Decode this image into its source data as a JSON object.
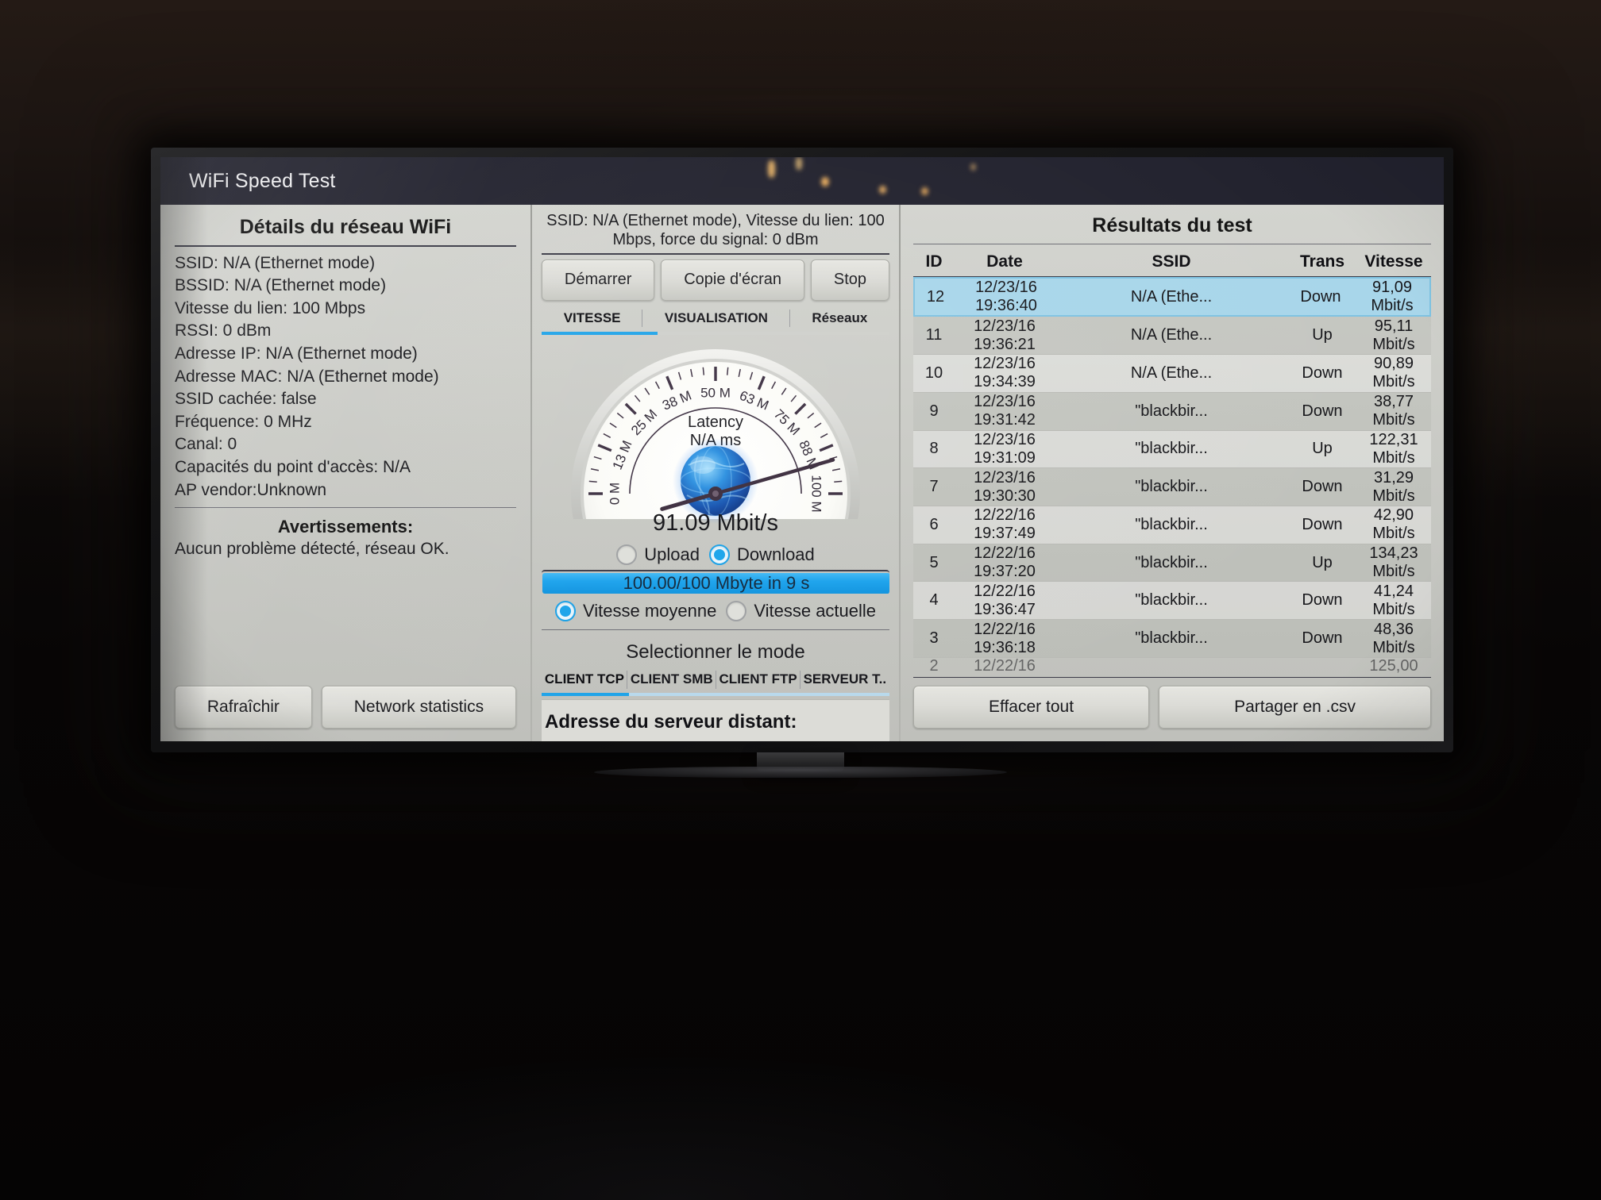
{
  "app": {
    "title": "WiFi Speed Test"
  },
  "left_panel": {
    "title": "Détails du réseau WiFi",
    "details": [
      "SSID: N/A (Ethernet mode)",
      "BSSID: N/A (Ethernet mode)",
      "Vitesse du lien: 100 Mbps",
      "RSSI: 0 dBm",
      "Adresse IP: N/A (Ethernet mode)",
      "Adresse MAC: N/A (Ethernet mode)",
      "SSID cachée: false",
      "Fréquence: 0 MHz",
      "Canal: 0",
      "Capacités du point d'accès: N/A",
      "AP vendor:Unknown"
    ],
    "warnings_title": "Avertissements:",
    "warnings_text": "Aucun problème détecté, réseau OK.",
    "buttons": {
      "refresh": "Rafraîchir",
      "network_statistics": "Network statistics"
    }
  },
  "center_panel": {
    "status_line": "SSID: N/A (Ethernet mode), Vitesse du lien: 100 Mbps, force du signal: 0 dBm",
    "buttons": {
      "start": "Démarrer",
      "screenshot": "Copie d'écran",
      "stop": "Stop"
    },
    "tabs": [
      {
        "label": "VITESSE",
        "active": true
      },
      {
        "label": "VISUALISATION",
        "active": false
      },
      {
        "label": "Réseaux",
        "active": false
      }
    ],
    "gauge": {
      "latency_label": "Latency",
      "latency_value": "N/A ms",
      "reading": "91.09 Mbit/s",
      "value": 91.09,
      "min": 0,
      "max": 100,
      "unit": "M",
      "tick_labels": [
        "0 M",
        "13 M",
        "25 M",
        "38 M",
        "50 M",
        "63 M",
        "75 M",
        "88 M",
        "100 M"
      ],
      "globe_icon": "globe-icon"
    },
    "direction": {
      "upload_label": "Upload",
      "download_label": "Download",
      "selected": "Download"
    },
    "progress": {
      "label": "100.00/100 Mbyte in 9 s",
      "percent": 100
    },
    "speed_mode": {
      "average_label": "Vitesse moyenne",
      "current_label": "Vitesse actuelle",
      "selected": "Vitesse moyenne"
    },
    "mode_title": "Selectionner le mode",
    "mode_tabs": [
      {
        "label": "CLIENT TCP",
        "active": true
      },
      {
        "label": "CLIENT SMB",
        "active": false
      },
      {
        "label": "CLIENT FTP",
        "active": false
      },
      {
        "label": "SERVEUR T..",
        "active": false
      }
    ],
    "server_label": "Adresse du serveur distant:"
  },
  "right_panel": {
    "title": "Résultats du test",
    "columns": [
      "ID",
      "Date",
      "SSID",
      "Trans",
      "Vitesse"
    ],
    "rows": [
      {
        "id": "12",
        "date": "12/23/16",
        "time": "19:36:40",
        "ssid": "N/A (Ethe...",
        "trans": "Down",
        "speed": "91,09",
        "unit": "Mbit/s",
        "selected": true
      },
      {
        "id": "11",
        "date": "12/23/16",
        "time": "19:36:21",
        "ssid": "N/A (Ethe...",
        "trans": "Up",
        "speed": "95,11",
        "unit": "Mbit/s",
        "selected": false
      },
      {
        "id": "10",
        "date": "12/23/16",
        "time": "19:34:39",
        "ssid": "N/A (Ethe...",
        "trans": "Down",
        "speed": "90,89",
        "unit": "Mbit/s",
        "selected": false
      },
      {
        "id": "9",
        "date": "12/23/16",
        "time": "19:31:42",
        "ssid": "\"blackbir...",
        "trans": "Down",
        "speed": "38,77",
        "unit": "Mbit/s",
        "selected": false
      },
      {
        "id": "8",
        "date": "12/23/16",
        "time": "19:31:09",
        "ssid": "\"blackbir...",
        "trans": "Up",
        "speed": "122,31",
        "unit": "Mbit/s",
        "selected": false
      },
      {
        "id": "7",
        "date": "12/23/16",
        "time": "19:30:30",
        "ssid": "\"blackbir...",
        "trans": "Down",
        "speed": "31,29",
        "unit": "Mbit/s",
        "selected": false
      },
      {
        "id": "6",
        "date": "12/22/16",
        "time": "19:37:49",
        "ssid": "\"blackbir...",
        "trans": "Down",
        "speed": "42,90",
        "unit": "Mbit/s",
        "selected": false
      },
      {
        "id": "5",
        "date": "12/22/16",
        "time": "19:37:20",
        "ssid": "\"blackbir...",
        "trans": "Up",
        "speed": "134,23",
        "unit": "Mbit/s",
        "selected": false
      },
      {
        "id": "4",
        "date": "12/22/16",
        "time": "19:36:47",
        "ssid": "\"blackbir...",
        "trans": "Down",
        "speed": "41,24",
        "unit": "Mbit/s",
        "selected": false
      },
      {
        "id": "3",
        "date": "12/22/16",
        "time": "19:36:18",
        "ssid": "\"blackbir...",
        "trans": "Down",
        "speed": "48,36",
        "unit": "Mbit/s",
        "selected": false
      }
    ],
    "partial_row": {
      "id": "2",
      "date": "12/22/16",
      "time": "",
      "ssid": "",
      "trans": "",
      "speed": "125,00",
      "unit": ""
    },
    "buttons": {
      "clear_all": "Effacer tout",
      "share_csv": "Partager en .csv"
    }
  },
  "colors": {
    "accent": "#1fa3e8",
    "selection": "#a8d6ea",
    "titlebar": "#22222e",
    "panel": "#cfd0cb"
  }
}
